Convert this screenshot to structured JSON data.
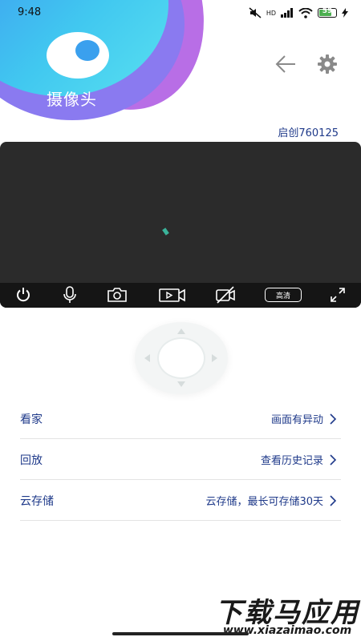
{
  "status_bar": {
    "time": "9:48",
    "network_label": "HD",
    "battery_level": "59"
  },
  "header": {
    "title": "摄像头",
    "device_name": "启创760125",
    "back_icon": "arrow-left-icon",
    "settings_icon": "gear-icon"
  },
  "video": {
    "toolbar": {
      "hd_label": "高清",
      "icons": [
        "power-icon",
        "microphone-icon",
        "camera-icon",
        "video-record-icon",
        "video-off-icon",
        "fullscreen-icon"
      ]
    }
  },
  "list": [
    {
      "label": "看家",
      "value": "画面有异动"
    },
    {
      "label": "回放",
      "value": "查看历史记录"
    },
    {
      "label": "云存储",
      "value": "云存储，最长可存储30天"
    }
  ],
  "watermark": {
    "title": "下载马应用",
    "url": "www.xiazaimao.com"
  },
  "colors": {
    "accent_text": "#1f3a8a",
    "video_bg": "#2b2b2b",
    "toolbar_bg": "#151515",
    "blob_gradient_start": "#3c8ef0",
    "blob_gradient_end": "#58e0f0",
    "blob_purple": "#b86ee6"
  }
}
